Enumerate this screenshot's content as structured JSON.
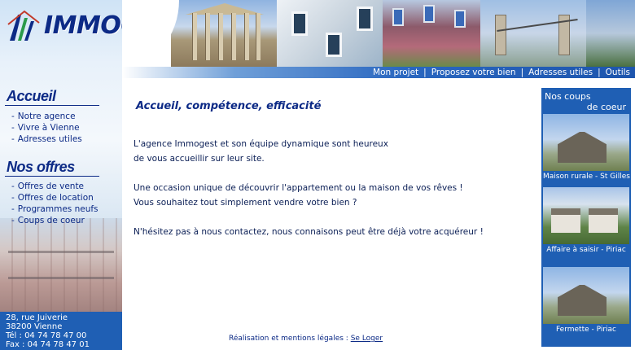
{
  "site": {
    "logo_text": "IMMOGEST"
  },
  "topnav": {
    "items": [
      "Mon projet",
      "Proposez votre bien",
      "Adresses utiles",
      "Outils"
    ],
    "separator": "|"
  },
  "sidebar": {
    "accueil": {
      "title": "Accueil",
      "items": [
        "Notre agence",
        "Vivre à Vienne",
        "Adresses utiles"
      ]
    },
    "offres": {
      "title": "Nos offres",
      "items": [
        "Offres de vente",
        "Offres de location",
        "Programmes neufs",
        "Coups de coeur"
      ]
    },
    "bullet": "-",
    "address": {
      "street": "28, rue Juiverie",
      "city": "38200 Vienne",
      "phone": "Tél : 04 74 78 47 00",
      "fax": "Fax : 04 74 78 47 01"
    }
  },
  "main": {
    "title": "Accueil, compétence, efficacité",
    "paragraphs": [
      [
        "L'agence Immogest et son équipe dynamique sont heureux",
        "de vous accueillir sur leur site."
      ],
      [
        "Une occasion unique de découvrir l'appartement ou la maison de vos rêves !",
        "Vous souhaitez tout simplement vendre votre bien ?"
      ],
      [
        "N'hésitez pas à nous contactez, nous connaisons peut être déjà votre acquéreur !"
      ]
    ],
    "footer": {
      "text": "Réalisation et mentions légales :",
      "link": "Se Loger"
    }
  },
  "coups_de_coeur": {
    "title_line1": "Nos coups",
    "title_line2": "de coeur",
    "cards": [
      {
        "caption": "Maison rurale - St Gilles",
        "image": "chapel-photo"
      },
      {
        "caption": "Affaire à saisir - Piriac",
        "image": "houses-photo"
      },
      {
        "caption": "Fermette - Piriac",
        "image": "chapel-photo"
      }
    ]
  },
  "colors": {
    "brand_blue": "#0c2a86",
    "panel_blue": "#1f5fb4",
    "text_blue": "#0a1e55"
  }
}
